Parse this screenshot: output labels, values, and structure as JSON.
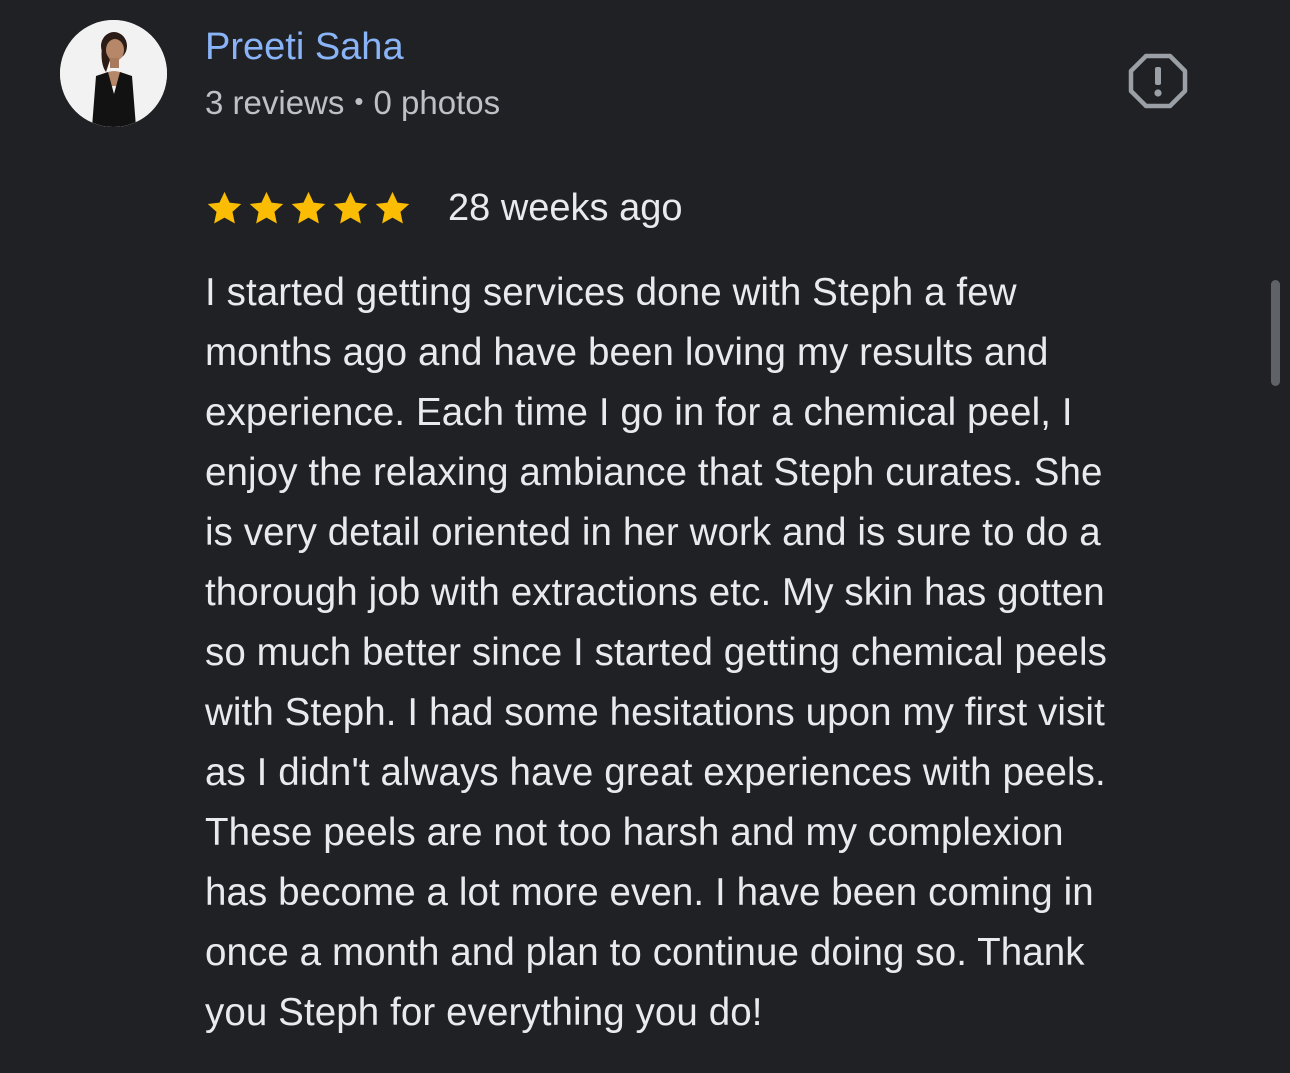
{
  "reviewer": {
    "name": "Preeti Saha",
    "reviews": "3 reviews",
    "separator": "•",
    "photos": "0 photos"
  },
  "review": {
    "rating": 5,
    "max_rating": 5,
    "date": "28 weeks ago",
    "text_lines": [
      "I started getting services done with Steph a few",
      "months ago and have been loving my results and",
      "experience. Each time I go in for a chemical peel, I",
      "enjoy the relaxing ambiance that Steph curates. She",
      "is very detail oriented in her work and is sure to do a",
      "thorough job with extractions etc. My skin has gotten",
      "so much better since I started getting chemical peels",
      "with Steph. I had some hesitations upon my first visit",
      "as I didn't always have great experiences with peels.",
      "These peels are not too harsh and my complexion",
      "has become a lot more even. I have been coming in",
      "once a month and plan to continue doing so. Thank",
      "you Steph for everything you do!"
    ]
  },
  "icons": {
    "report": "report-icon",
    "star": "star-icon"
  },
  "colors": {
    "background": "#202124",
    "name": "#8ab4f8",
    "text": "#e8eaed",
    "meta": "#bdc1c6",
    "star": "#fbbc04",
    "icon": "#9aa0a6",
    "scrollbar": "#5f6368"
  }
}
